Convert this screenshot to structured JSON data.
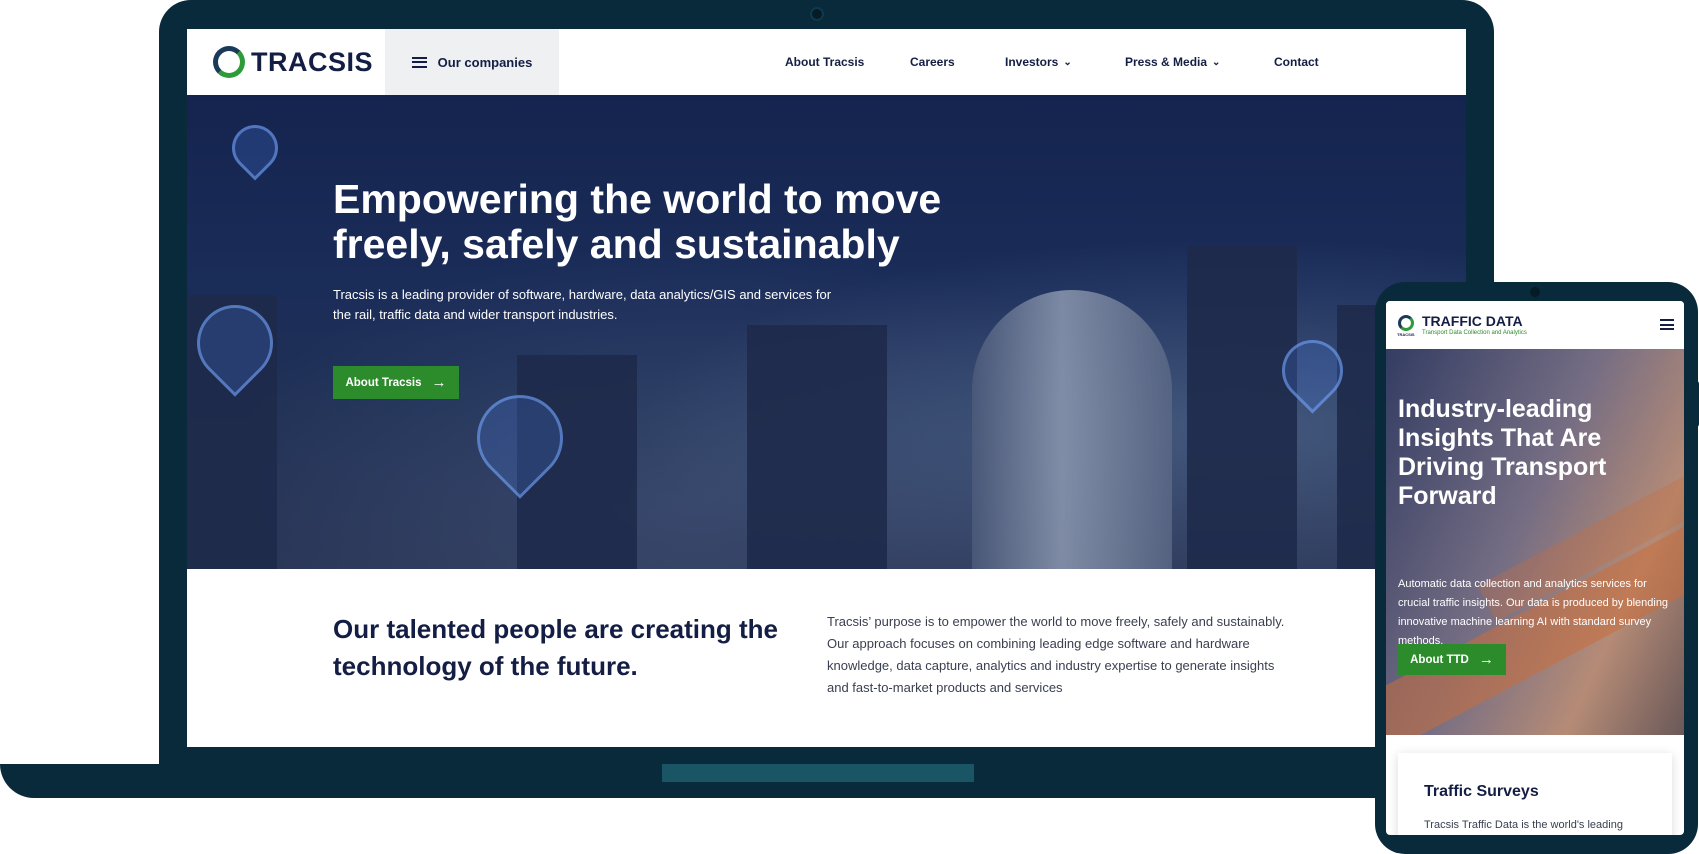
{
  "laptop": {
    "header": {
      "logo": "TRACSIS",
      "companies_button": "Our companies",
      "nav": [
        {
          "label": "About Tracsis",
          "has_dropdown": false
        },
        {
          "label": "Careers",
          "has_dropdown": false
        },
        {
          "label": "Investors",
          "has_dropdown": true
        },
        {
          "label": "Press & Media",
          "has_dropdown": true
        },
        {
          "label": "Contact",
          "has_dropdown": false
        }
      ]
    },
    "hero": {
      "title": "Empowering the world to move freely, safely and sustainably",
      "subtitle": "Tracsis is a leading provider of software, hardware, data analytics/GIS and services for the rail, traffic data and wider transport industries.",
      "cta": "About Tracsis"
    },
    "section": {
      "title": "Our talented people are creating the technology of the future.",
      "text": "Tracsis’ purpose is to empower the world to move freely, safely and sustainably. Our approach focuses on combining leading edge software and hardware knowledge, data capture, analytics and industry expertise to generate insights and fast-to-market products and services"
    }
  },
  "phone": {
    "header": {
      "logo_small": "TRACSIS",
      "brand": "TRAFFIC DATA",
      "tagline": "Transport Data Collection and Analytics"
    },
    "hero": {
      "title": "Industry-leading Insights That Are Driving Transport Forward",
      "subtitle": "Automatic data collection and analytics services for crucial traffic insights. Our data is produced by blending innovative machine learning AI with standard survey methods.",
      "cta": "About TTD"
    },
    "card": {
      "title": "Traffic Surveys",
      "text": "Tracsis Traffic Data is the world's leading"
    }
  },
  "colors": {
    "device_frame": "#092a3a",
    "brand_navy": "#141e44",
    "brand_green": "#2c8b2a",
    "companies_bg": "#eef0f2"
  },
  "icons": [
    "menu-icon",
    "chevron-down-icon",
    "arrow-right-icon",
    "logo-icon"
  ]
}
